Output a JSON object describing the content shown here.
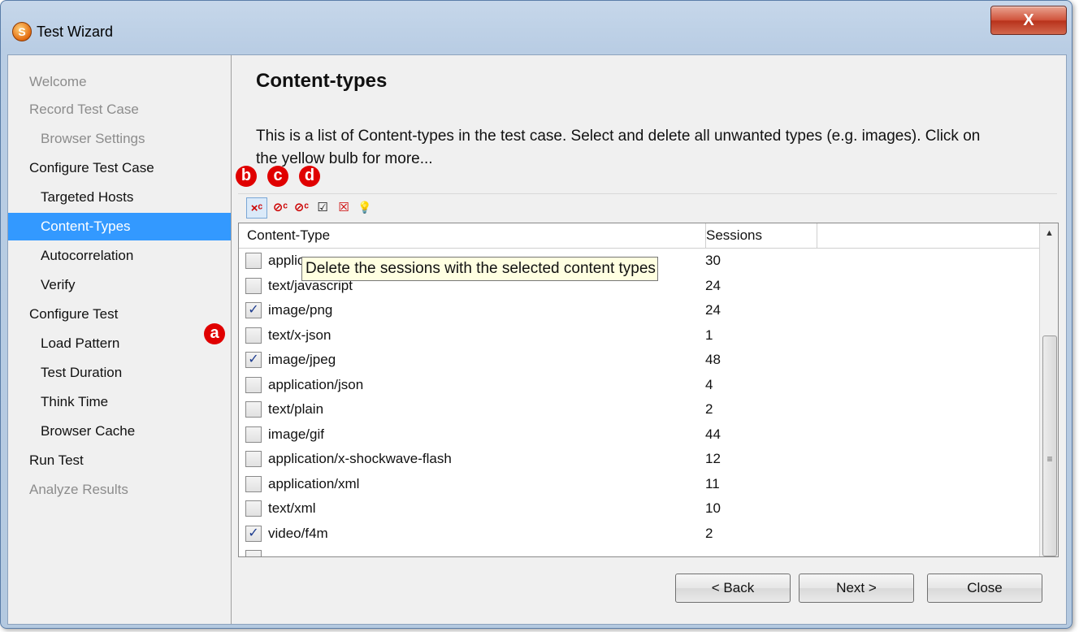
{
  "window": {
    "title": "Test Wizard",
    "app_icon": "S",
    "close_label": "X"
  },
  "nav": {
    "items": [
      {
        "label": "Welcome",
        "state": "disabled"
      },
      {
        "label": "Record Test Case",
        "state": "disabled"
      },
      {
        "label": "Browser Settings",
        "state": "disabled"
      },
      {
        "label": "Configure Test Case",
        "state": "normal"
      },
      {
        "label": "Targeted Hosts",
        "state": "normal"
      },
      {
        "label": "Content-Types",
        "state": "selected"
      },
      {
        "label": "Autocorrelation",
        "state": "normal"
      },
      {
        "label": "Verify",
        "state": "normal"
      },
      {
        "label": "Configure Test",
        "state": "normal"
      },
      {
        "label": "Load Pattern",
        "state": "normal"
      },
      {
        "label": "Test Duration",
        "state": "normal"
      },
      {
        "label": "Think Time",
        "state": "normal"
      },
      {
        "label": "Browser Cache",
        "state": "normal"
      },
      {
        "label": "Run Test",
        "state": "normal"
      },
      {
        "label": "Analyze Results",
        "state": "disabled"
      }
    ]
  },
  "main": {
    "heading": "Content-types",
    "description": "This is a list of Content-types in the test case. Select and delete all unwanted types (e.g. images). Click on the yellow bulb for more..."
  },
  "toolbar": {
    "buttons": [
      {
        "icon": "delete-sessions-icon",
        "glyph": "×ᶜ"
      },
      {
        "icon": "add-content-type-icon",
        "glyph": "⊘ᶜ"
      },
      {
        "icon": "remove-content-type-icon",
        "glyph": "⊘ᶜ"
      },
      {
        "icon": "check-all-icon",
        "glyph": "☑"
      },
      {
        "icon": "uncheck-all-icon",
        "glyph": "☒"
      },
      {
        "icon": "lightbulb-icon",
        "glyph": "💡"
      }
    ]
  },
  "table": {
    "columns": [
      "Content-Type",
      "Sessions"
    ],
    "rows": [
      {
        "type": "applic",
        "sessions": "30",
        "checked": false
      },
      {
        "type": "text/javascript",
        "sessions": "24",
        "checked": false
      },
      {
        "type": "image/png",
        "sessions": "24",
        "checked": true
      },
      {
        "type": "text/x-json",
        "sessions": "1",
        "checked": false
      },
      {
        "type": "image/jpeg",
        "sessions": "48",
        "checked": true
      },
      {
        "type": "application/json",
        "sessions": "4",
        "checked": false
      },
      {
        "type": "text/plain",
        "sessions": "2",
        "checked": false
      },
      {
        "type": "image/gif",
        "sessions": "44",
        "checked": false
      },
      {
        "type": "application/x-shockwave-flash",
        "sessions": "12",
        "checked": false
      },
      {
        "type": "application/xml",
        "sessions": "11",
        "checked": false
      },
      {
        "type": "text/xml",
        "sessions": "10",
        "checked": false
      },
      {
        "type": "video/f4m",
        "sessions": "2",
        "checked": true
      }
    ],
    "tooltip": "Delete the sessions with the selected content types"
  },
  "markers": {
    "a": "a",
    "b": "b",
    "c": "c",
    "d": "d"
  },
  "buttons": {
    "back": "< Back",
    "next": "Next >",
    "close": "Close"
  }
}
